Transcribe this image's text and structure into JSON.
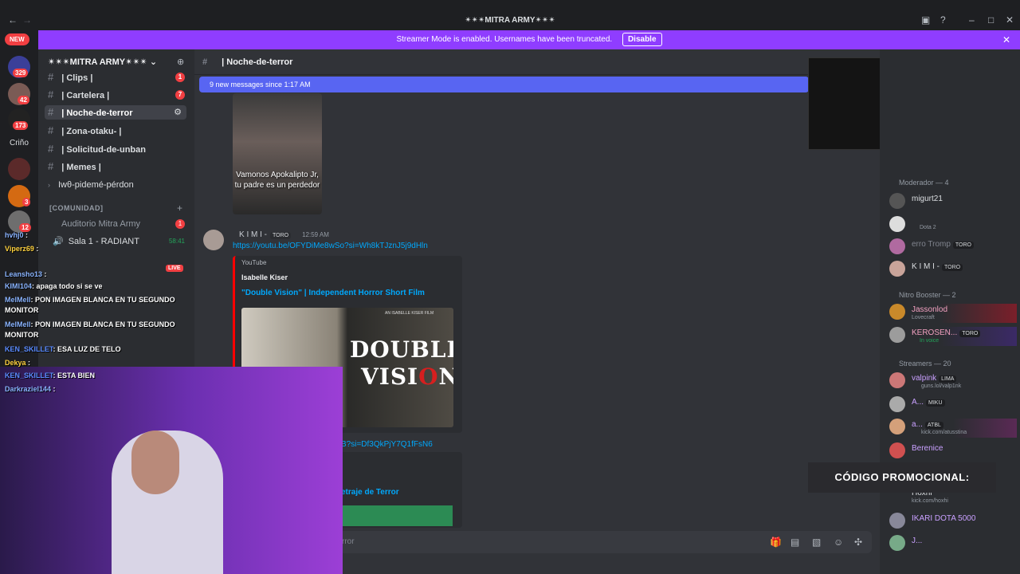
{
  "window": {
    "title": "✴✴✴MITRA ARMY✴✴✴"
  },
  "banner": {
    "text": "Streamer Mode is enabled. Usernames have been truncated.",
    "button": "Disable"
  },
  "rail": {
    "new_badge": "NEW",
    "badges": [
      "329",
      "42",
      "173",
      "3",
      "12"
    ],
    "label": "Criño"
  },
  "server": {
    "name": "✴✴✴MITRA ARMY✴✴✴"
  },
  "channels": [
    {
      "name": "| Clips |",
      "count": "1"
    },
    {
      "name": "| Cartelera |",
      "count": "7"
    },
    {
      "name": "| Noche-de-terror",
      "count": ""
    },
    {
      "name": "| Zona-otaku- |",
      "count": ""
    },
    {
      "name": "| Solicitud-de-unban",
      "count": ""
    },
    {
      "name": "| Memes |",
      "count": ""
    },
    {
      "name": "Iwθ-pidemé-pérdon",
      "count": ""
    }
  ],
  "category": "[COMUNIDAD]",
  "voice": {
    "auditorio": "Auditorio Mitra Army",
    "auditorio_count": "1",
    "sala": "Sala 1 - RADIANT",
    "sala_time": "58:41",
    "live": "LIVE"
  },
  "header": {
    "channel": "| Noche-de-terror"
  },
  "new_messages": "9 new messages since 1:17 AM",
  "messages": {
    "image_caption": "Vamonos Apokalipto Jr, tu padre es un perdedor",
    "author": "K I M I -",
    "author_tag": "TORO",
    "time": "12:59 AM",
    "link": "https://youtu.be/OFYDiMe8wSo?si=Wh8kTJznJ5j9dHln",
    "embed_provider": "YouTube",
    "embed_author": "Isabelle Kiser",
    "embed_title": "\"Double Vision\" | Independent Horror Short Film",
    "thumb_small": "AN ISABELLE KISER FILM",
    "thumb_t1": "D",
    "thumb_t1b": "OUBLE",
    "thumb_t2a": "VISI",
    "thumb_t2b": "O",
    "thumb_t2c": "N",
    "link2": "B?si=Df3QkPjY7Q1fFsN6",
    "embed2_title": "etraje de Terror",
    "input_placeholder": "rror"
  },
  "members": {
    "moderador": "Moderador — 4",
    "nitro": "Nitro Booster — 2",
    "streamers": "Streamers — 20",
    "list": [
      {
        "name": "migurt21",
        "sub": ""
      },
      {
        "name": "",
        "sub": "Dota 2"
      },
      {
        "name": "erro Tromp",
        "sub": "",
        "tag": "TORO"
      },
      {
        "name": "K I M I -",
        "sub": "",
        "tag": "TORO"
      },
      {
        "name": "Jassonlod",
        "sub": "Lovecraft"
      },
      {
        "name": "KEROSEN...",
        "sub": "In voice",
        "tag": "TORO"
      },
      {
        "name": "valpink",
        "sub": "guns.lol/valp1nk",
        "tag": "LIMA"
      },
      {
        "name": "A...",
        "sub": "",
        "tag": "MIKU"
      },
      {
        "name": "a...",
        "sub": "kick.com/atusstina",
        "tag": "ATBL"
      },
      {
        "name": "Berenice",
        "sub": ""
      },
      {
        "name": "Hoxhi",
        "sub": "kick.com/hoxhi"
      },
      {
        "name": "IKARI DOTA 5000",
        "sub": ""
      },
      {
        "name": "J...",
        "sub": ""
      }
    ]
  },
  "promo": "CÓDIGO PROMOCIONAL:",
  "chat": [
    {
      "user": "hvhj0",
      "msg": ""
    },
    {
      "user": "Viperz69",
      "msg": ""
    },
    {
      "user": "Leansho13",
      "msg": ""
    },
    {
      "user": "KIMI104",
      "msg": ": apaga todo si se ve"
    },
    {
      "user": "MelMell",
      "msg": ": PON IMAGEN BLANCA EN TU SEGUNDO MONITOR"
    },
    {
      "user": "MelMell",
      "msg": ": PON IMAGEN BLANCA EN TU SEGUNDO MONITOR"
    },
    {
      "user": "KEN_SKILLET",
      "msg": ": ESA LUZ DE TELO"
    },
    {
      "user": "Dekya",
      "msg": ""
    },
    {
      "user": "KEN_SKILLET",
      "msg": ": ESTA BIEN"
    },
    {
      "user": "Darkraziel144",
      "msg": ""
    }
  ],
  "colors": {
    "accent": "#8f3dff",
    "blurple": "#5865f2",
    "link": "#00a8fc",
    "red": "#f23f42"
  }
}
